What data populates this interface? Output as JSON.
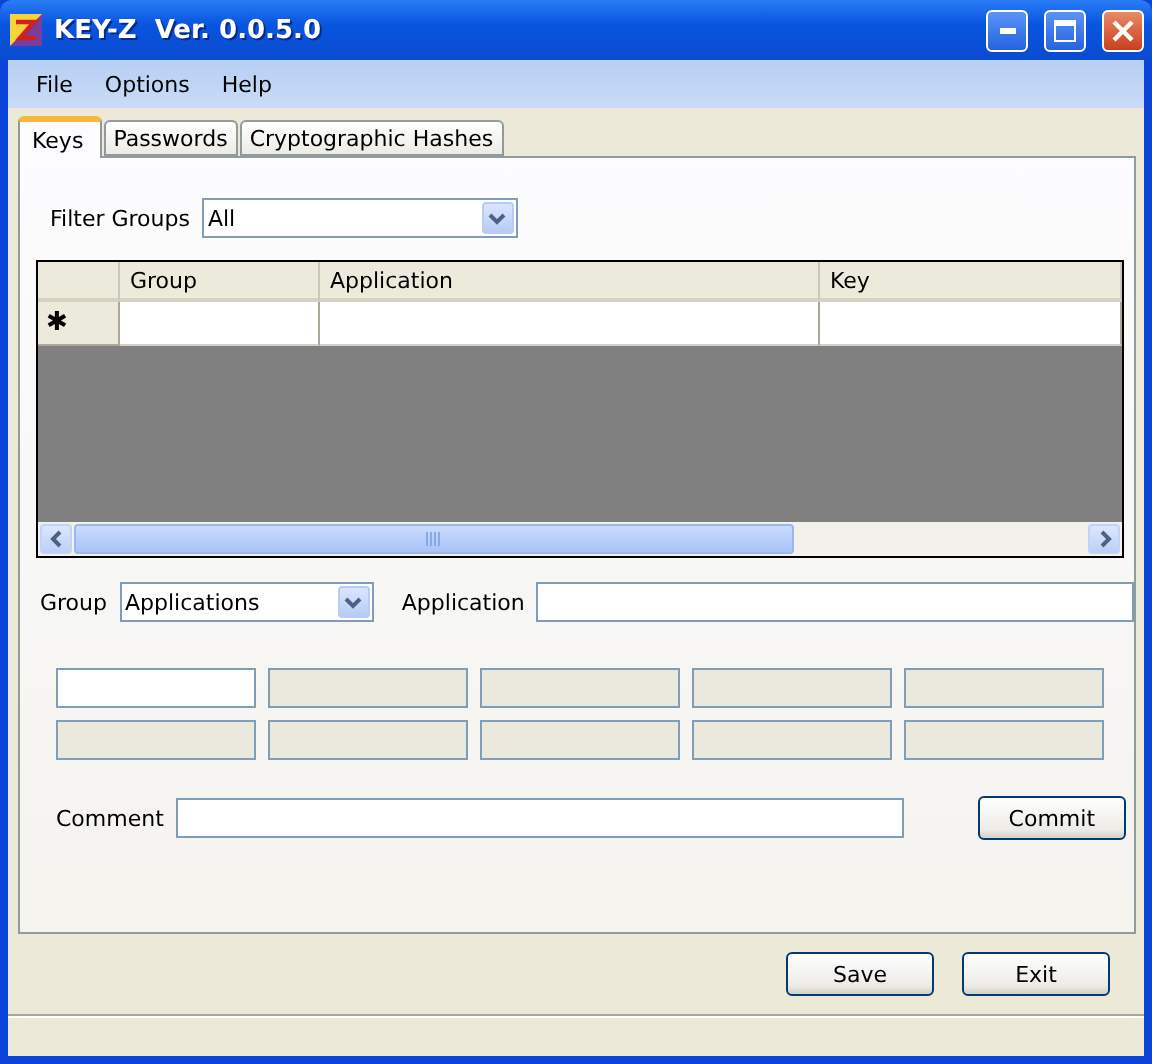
{
  "window": {
    "title": "KEY-Z  Ver. 0.0.5.0"
  },
  "menu": [
    "File",
    "Options",
    "Help"
  ],
  "tabs": [
    {
      "label": "Keys",
      "selected": true
    },
    {
      "label": "Passwords",
      "selected": false
    },
    {
      "label": "Cryptographic Hashes",
      "selected": false
    }
  ],
  "filter": {
    "label": "Filter Groups",
    "value": "All"
  },
  "table": {
    "columns": [
      "Group",
      "Application",
      "Key"
    ],
    "new_row_marker": "✱"
  },
  "entry": {
    "group_label": "Group",
    "group_value": "Applications",
    "application_label": "Application"
  },
  "key_fields": [
    {
      "disabled": false
    },
    {
      "disabled": true
    },
    {
      "disabled": true
    },
    {
      "disabled": true
    },
    {
      "disabled": true
    },
    {
      "disabled": true
    },
    {
      "disabled": true
    },
    {
      "disabled": true
    },
    {
      "disabled": true
    },
    {
      "disabled": true
    }
  ],
  "comment": {
    "label": "Comment",
    "button": "Commit"
  },
  "buttons": [
    "Save",
    "Exit"
  ]
}
